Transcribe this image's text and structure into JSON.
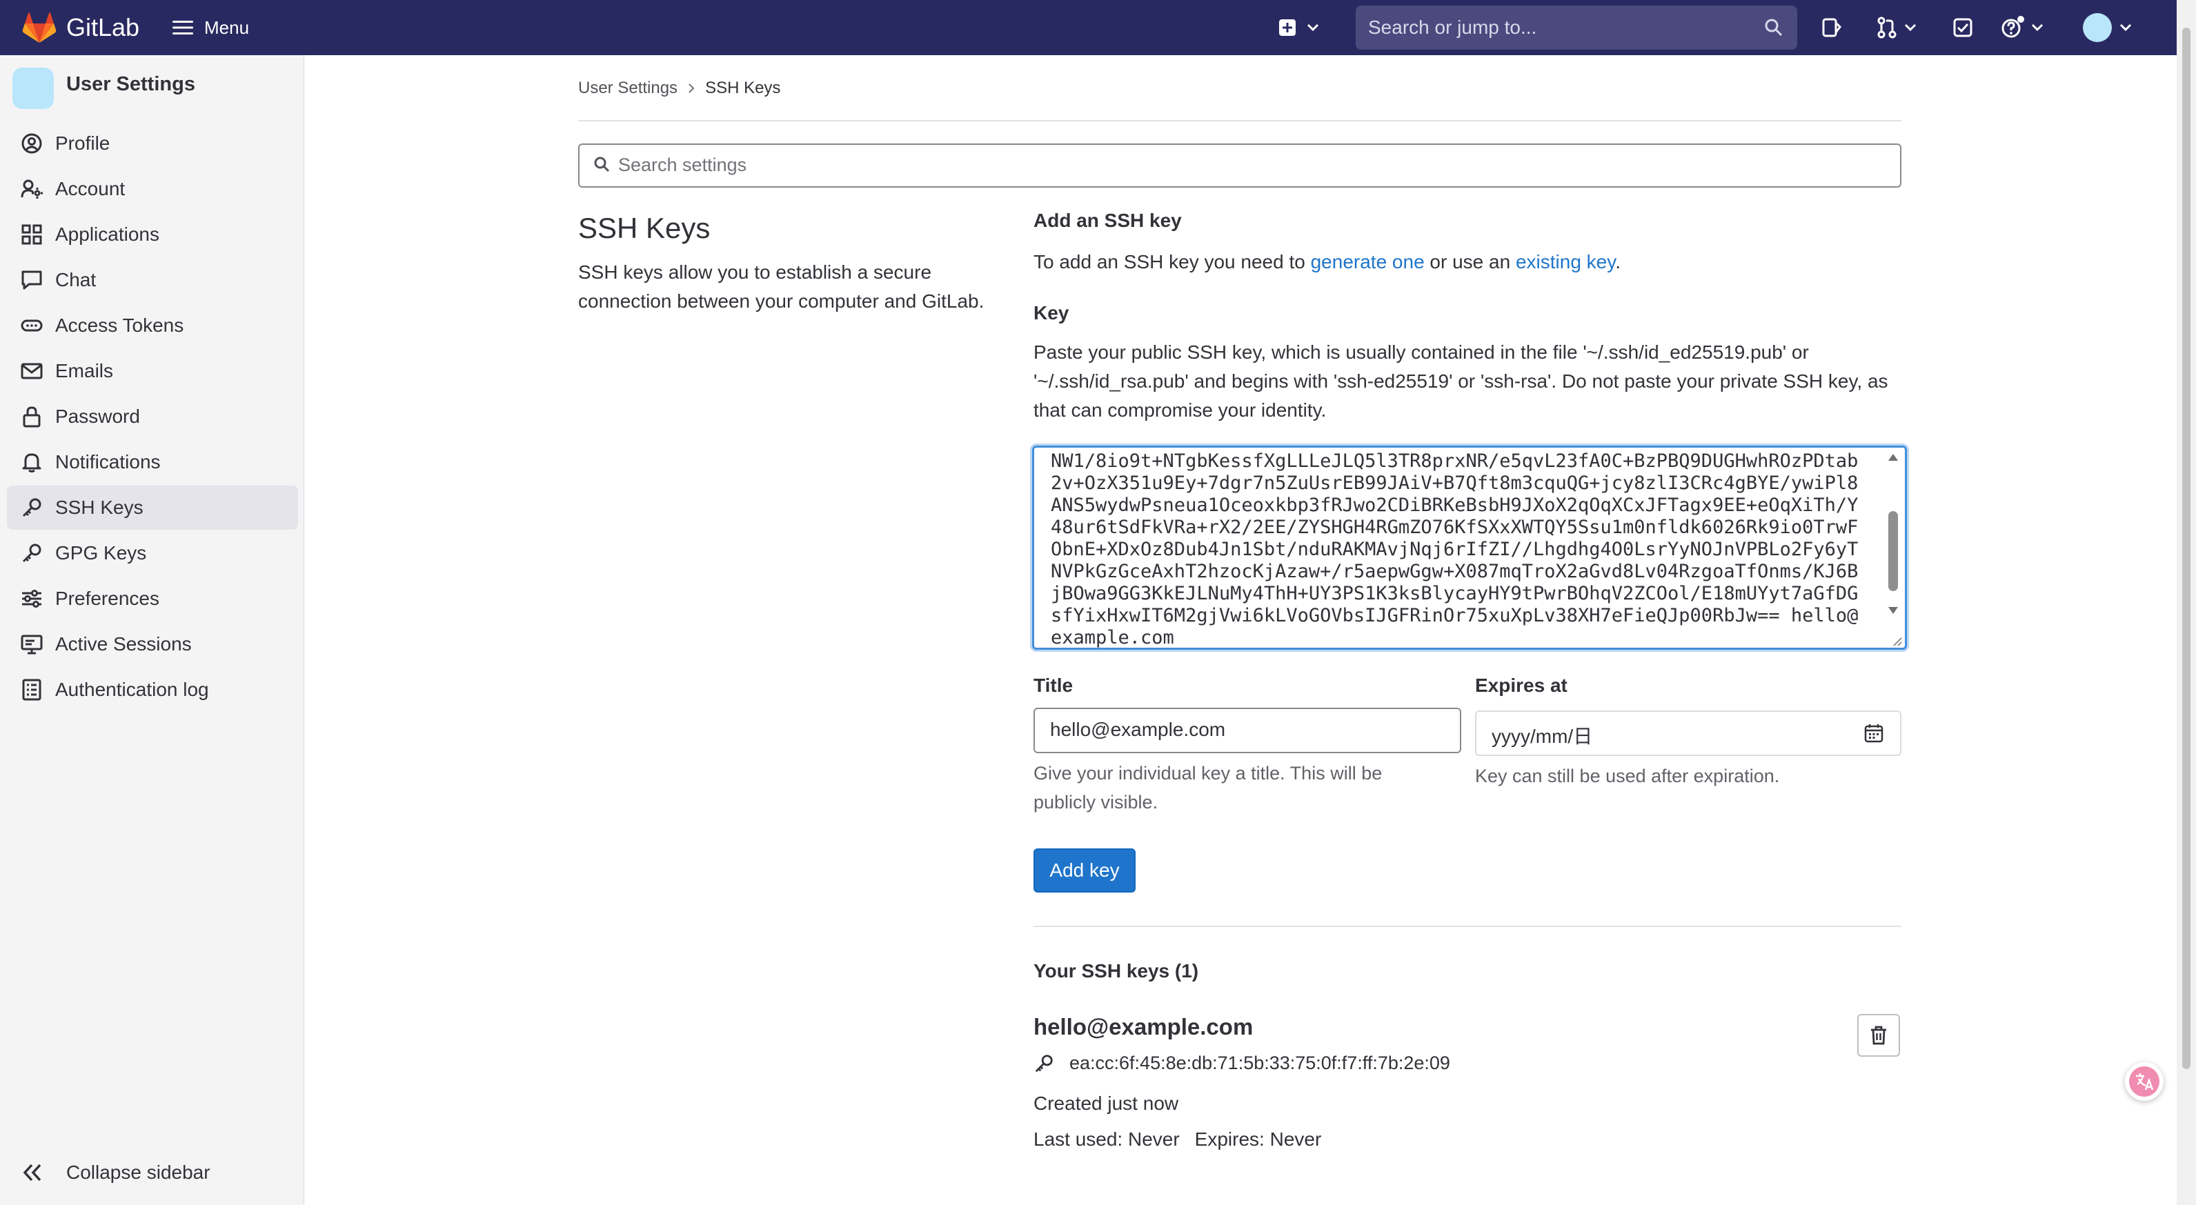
{
  "navbar": {
    "brand": "GitLab",
    "menu_label": "Menu",
    "search_placeholder": "Search or jump to...",
    "bg_color": "#292961"
  },
  "sidebar": {
    "title": "User Settings",
    "items": [
      {
        "label": "Profile",
        "icon": "profile-icon"
      },
      {
        "label": "Account",
        "icon": "account-icon"
      },
      {
        "label": "Applications",
        "icon": "applications-icon"
      },
      {
        "label": "Chat",
        "icon": "chat-icon"
      },
      {
        "label": "Access Tokens",
        "icon": "token-icon"
      },
      {
        "label": "Emails",
        "icon": "mail-icon"
      },
      {
        "label": "Password",
        "icon": "lock-icon"
      },
      {
        "label": "Notifications",
        "icon": "bell-icon"
      },
      {
        "label": "SSH Keys",
        "icon": "key-icon",
        "active": true
      },
      {
        "label": "GPG Keys",
        "icon": "key-icon"
      },
      {
        "label": "Preferences",
        "icon": "preferences-icon"
      },
      {
        "label": "Active Sessions",
        "icon": "monitor-icon"
      },
      {
        "label": "Authentication log",
        "icon": "log-icon"
      }
    ],
    "collapse_label": "Collapse sidebar"
  },
  "breadcrumb": {
    "parent": "User Settings",
    "current": "SSH Keys"
  },
  "settings_search": {
    "placeholder": "Search settings"
  },
  "section": {
    "title": "SSH Keys",
    "description": "SSH keys allow you to establish a secure connection between your computer and GitLab."
  },
  "add_key": {
    "title": "Add an SSH key",
    "intro_prefix": "To add an SSH key you need to ",
    "generate_link": "generate one",
    "intro_middle": " or use an ",
    "existing_link": "existing key",
    "intro_suffix": ".",
    "key_label": "Key",
    "key_help": "Paste your public SSH key, which is usually contained in the file '~/.ssh/id_ed25519.pub' or '~/.ssh/id_rsa.pub' and begins with 'ssh-ed25519' or 'ssh-rsa'. Do not paste your private SSH key, as that can compromise your identity.",
    "key_value": "NW1/8io9t+NTgbKessfXgLLLeJLQ5l3TR8prxNR/e5qvL23fA0C+BzPBQ9DUGHwhROzPDtab2v+OzX351u9Ey+7dgr7n5ZuUsrEB99JAiV+B7Qft8m3cquQG+jcy8zlI3CRc4gBYE/ywiPl8ANS5wydwPsneua1Oceoxkbp3fRJwo2CDiBRKeBsbH9JXoX2qOqXCxJFTagx9EE+eOqXiTh/Y48ur6tSdFkVRa+rX2/2EE/ZYSHGH4RGmZO76KfSXxXWTQY5Ssu1m0nfldk6026Rk9io0TrwFObnE+XDxOz8Dub4Jn1Sbt/nduRAKMAvjNqj6rIfZI//Lhgdhg4O0LsrYyNOJnVPBLo2Fy6yTNVPkGzGceAxhT2hzocKjAzaw+/r5aepwGgw+X087mqTroX2aGvd8Lv04RzgoaTfOnms/KJ6BjBOwa9GG3KkEJLNuMy4ThH+UY3PS1K3ksBlycayHY9tPwrBOhqV2ZCOol/E18mUYyt7aGfDGsfYixHxwIT6M2gjVwi6kLVoGOVbsIJGFRinOr75xuXpLv38XH7eFieQJp00RbJw== hello@example.com",
    "title_label": "Title",
    "title_value": "hello@example.com",
    "title_help": "Give your individual key a title. This will be publicly visible.",
    "expires_label": "Expires at",
    "expires_value": "yyyy/mm/日",
    "expires_help": "Key can still be used after expiration.",
    "submit_label": "Add key",
    "primary_color": "#1f75cb"
  },
  "your_keys": {
    "title": "Your SSH keys (1)",
    "keys": [
      {
        "name": "hello@example.com",
        "fingerprint": "ea:cc:6f:45:8e:db:71:5b:33:75:0f:f7:ff:7b:2e:09",
        "created": "Created just now",
        "last_used": "Last used: Never",
        "expires": "Expires: Never"
      }
    ]
  }
}
